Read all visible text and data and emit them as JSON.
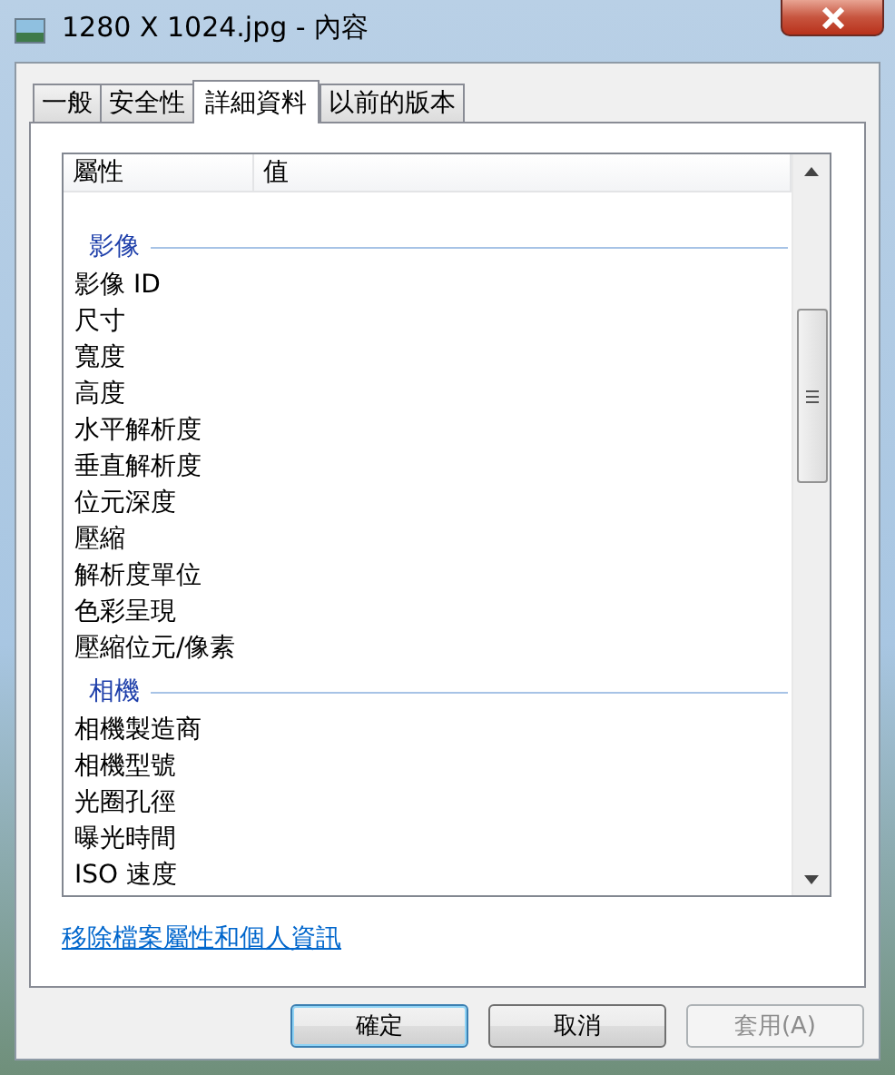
{
  "window": {
    "title": "1280 X 1024.jpg - 內容"
  },
  "tabs": [
    {
      "label": "一般",
      "selected": false
    },
    {
      "label": "安全性",
      "selected": false
    },
    {
      "label": "詳細資料",
      "selected": true
    },
    {
      "label": "以前的版本",
      "selected": false
    }
  ],
  "table": {
    "columns": [
      "屬性",
      "值"
    ],
    "rows": [
      {
        "kind": "group",
        "label": "影像"
      },
      {
        "kind": "property",
        "label": "影像 ID"
      },
      {
        "kind": "property",
        "label": "尺寸"
      },
      {
        "kind": "property",
        "label": "寬度"
      },
      {
        "kind": "property",
        "label": "高度"
      },
      {
        "kind": "property",
        "label": "水平解析度"
      },
      {
        "kind": "property",
        "label": "垂直解析度"
      },
      {
        "kind": "property",
        "label": "位元深度"
      },
      {
        "kind": "property",
        "label": "壓縮"
      },
      {
        "kind": "property",
        "label": "解析度單位"
      },
      {
        "kind": "property",
        "label": "色彩呈現"
      },
      {
        "kind": "property",
        "label": "壓縮位元/像素"
      },
      {
        "kind": "group",
        "label": "相機"
      },
      {
        "kind": "property",
        "label": "相機製造商"
      },
      {
        "kind": "property",
        "label": "相機型號"
      },
      {
        "kind": "property",
        "label": "光圈孔徑"
      },
      {
        "kind": "property",
        "label": "曝光時間"
      },
      {
        "kind": "property",
        "label": "ISO 速度"
      }
    ]
  },
  "link": "移除檔案屬性和個人資訊",
  "buttons": [
    {
      "label": "確定",
      "default": true,
      "disabled": false
    },
    {
      "label": "取消",
      "default": false,
      "disabled": false
    },
    {
      "label": "套用(A)",
      "default": false,
      "disabled": true
    }
  ]
}
